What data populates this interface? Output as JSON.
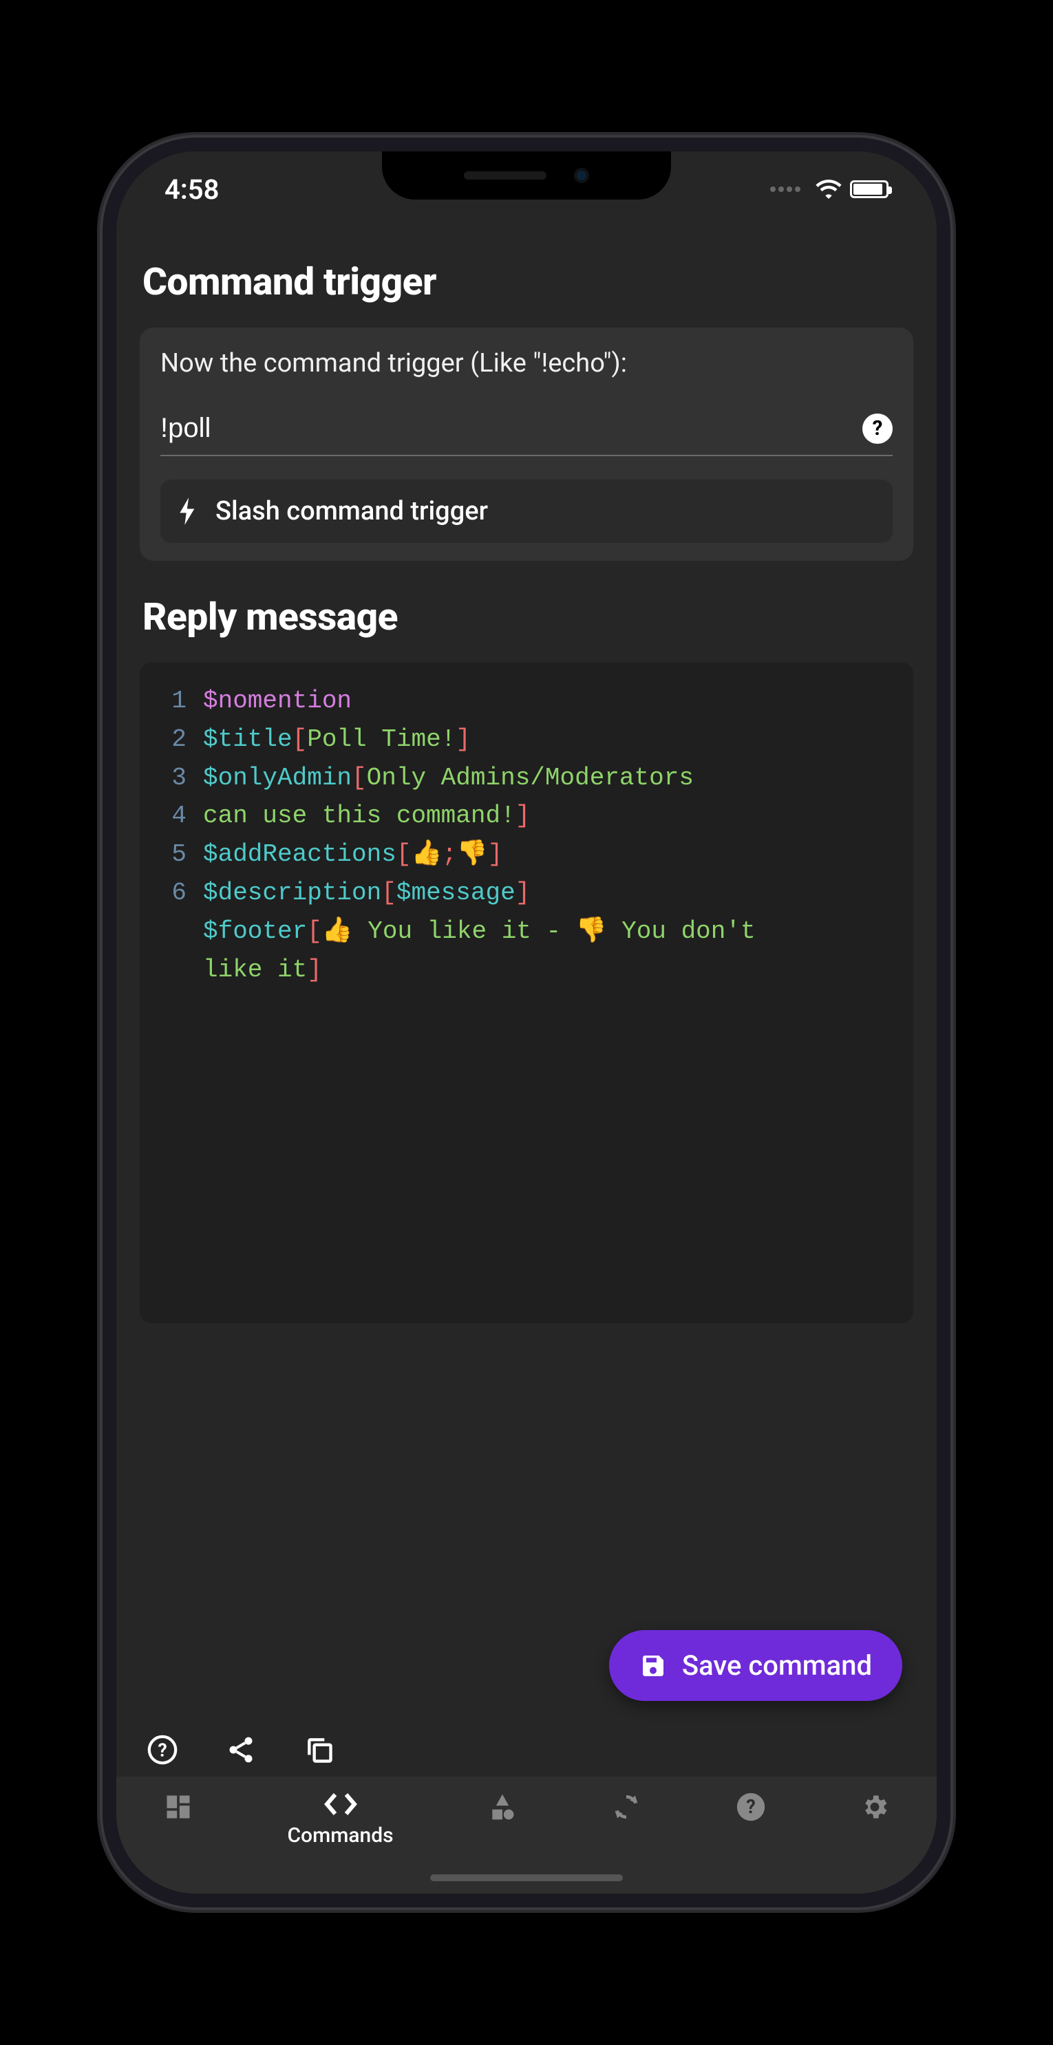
{
  "status": {
    "time": "4:58"
  },
  "headings": {
    "trigger": "Command trigger",
    "reply": "Reply message"
  },
  "trigger_card": {
    "label": "Now the command trigger (Like \"!echo\"):",
    "value": "!poll",
    "slash_label": "Slash command trigger"
  },
  "code": {
    "raw": "$nomention\n$title[Poll Time!]\n$onlyAdmin[Only Admins/Moderators can use this command!]\n$addReactions[👍;👎]\n$description[$message]\n$footer[👍 You like it - 👎 You don't like it]",
    "lines": [
      {
        "n": "1",
        "tokens": [
          [
            "v",
            "$nomention"
          ]
        ]
      },
      {
        "n": "2",
        "tokens": [
          [
            "fn",
            "$title"
          ],
          [
            "br",
            "["
          ],
          [
            "ar",
            "Poll Time!"
          ],
          [
            "br",
            "]"
          ]
        ]
      },
      {
        "n": "3",
        "tokens": [
          [
            "fn",
            "$onlyAdmin"
          ],
          [
            "br",
            "["
          ],
          [
            "ar",
            "Only Admins/Moderators"
          ]
        ]
      },
      {
        "n": "4",
        "tokens": [
          [
            "ar",
            "can use this command!"
          ],
          [
            "br",
            "]"
          ]
        ]
      },
      {
        "n": "5",
        "tokens": [
          [
            "fn",
            "$addReactions"
          ],
          [
            "br",
            "["
          ],
          [
            "ar",
            "👍"
          ],
          [
            "br",
            ";"
          ],
          [
            "ar",
            "👎"
          ],
          [
            "br",
            "]"
          ]
        ]
      },
      {
        "n": "6",
        "tokens": [
          [
            "fn",
            "$description"
          ],
          [
            "br",
            "["
          ],
          [
            "nv",
            "$message"
          ],
          [
            "br",
            "]"
          ]
        ]
      },
      {
        "n": "",
        "tokens": [
          [
            "fn",
            "$footer"
          ],
          [
            "br",
            "["
          ],
          [
            "ar",
            "👍 You like it - 👎 You don't"
          ]
        ]
      },
      {
        "n": "",
        "tokens": [
          [
            "ar",
            "like it"
          ],
          [
            "br",
            "]"
          ]
        ]
      }
    ]
  },
  "fab": {
    "label": "Save command"
  },
  "bottomnav": {
    "items": [
      {
        "icon": "dashboard-icon",
        "label": ""
      },
      {
        "icon": "code-icon",
        "label": "Commands",
        "active": true
      },
      {
        "icon": "shapes-icon",
        "label": ""
      },
      {
        "icon": "refresh-icon",
        "label": ""
      },
      {
        "icon": "help-icon",
        "label": ""
      },
      {
        "icon": "gear-icon",
        "label": ""
      }
    ]
  },
  "colors": {
    "accent": "#6f2bd9",
    "bg": "#262626",
    "card": "#333333",
    "code_bg": "#1f1f1f"
  }
}
